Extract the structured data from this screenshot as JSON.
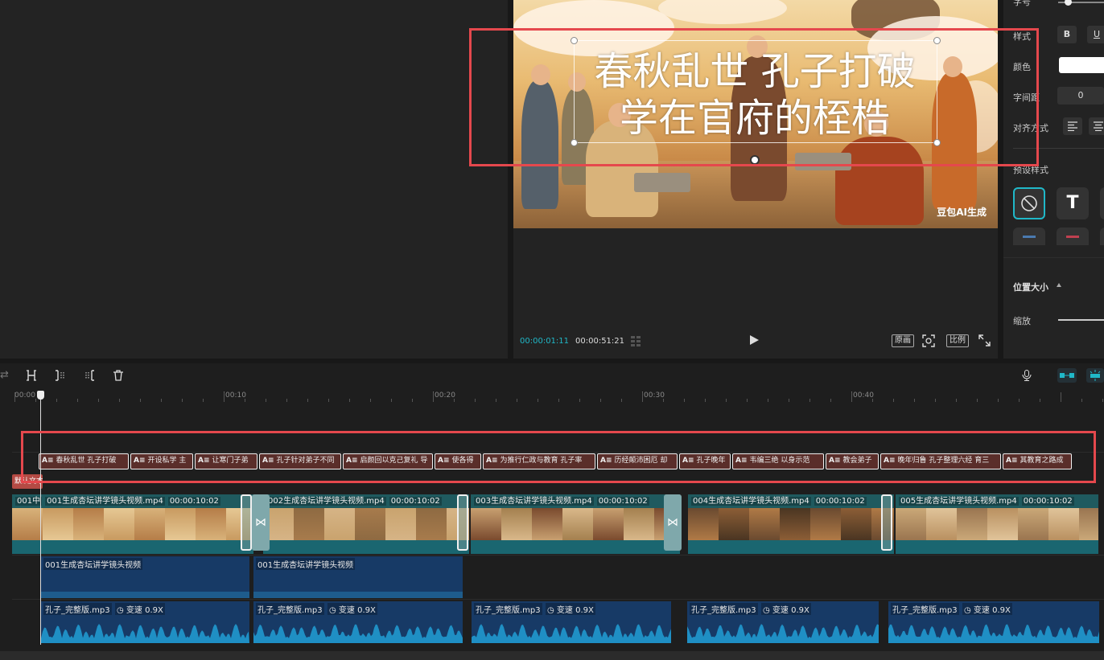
{
  "media_panel": {
    "tab_label": ""
  },
  "preview": {
    "subtitle_line1": "春秋乱世 孔子打破",
    "subtitle_line2": "学在官府的桎梏",
    "watermark": "豆包AI生成",
    "time_current": "00:00:01:11",
    "time_total": "00:00:51:21",
    "btn_original": "原画",
    "btn_ratio": "比例"
  },
  "properties": {
    "font_size_label": "字号",
    "style_label": "样式",
    "bold": "B",
    "underline": "U",
    "color_label": "颜色",
    "spacing_label": "字间距",
    "spacing_value": "0",
    "align_label": "对齐方式",
    "preset_label": "预设样式",
    "preset_t": "T",
    "position_label": "位置大小",
    "scale_label": "缩放"
  },
  "timeline": {
    "ruler": [
      "00:00",
      "|00:10",
      "|00:20",
      "|00:30",
      "|00:40"
    ],
    "text_tag": "默认文本",
    "captions": [
      "春秋乱世 孔子打破",
      "开设私学 主",
      "让寒门子弟",
      "孔子针对弟子不同",
      "启颜回以克己复礼 导",
      "使各得",
      "为推行仁政与教育 孔子率",
      "历经颠沛困厄 却",
      "孔子晚年",
      "韦编三绝 以身示范",
      "教会弟子",
      "晚年归鲁 孔子整理六经 育三",
      "其教育之路成"
    ],
    "caption_badge": "A≡",
    "video_clips": [
      {
        "name": "001生成杏坛讲学镜头视频.mp4",
        "duration": "00:00:10:02",
        "prefix": "001中"
      },
      {
        "name": "002生成杏坛讲学镜头视频.mp4",
        "duration": "00:00:10:02"
      },
      {
        "name": "003生成杏坛讲学镜头视频.mp4",
        "duration": "00:00:10:02"
      },
      {
        "name": "004生成杏坛讲学镜头视频.mp4",
        "duration": "00:00:10:02"
      },
      {
        "name": "005生成杏坛讲学镜头视频.mp4",
        "duration": "00:00:10:02"
      }
    ],
    "video_audio_clips": [
      "001生成杏坛讲学镜头视频",
      "001生成杏坛讲学镜头视频"
    ],
    "music_clip": {
      "name": "孔子_完整版.mp3",
      "speed": "变速 0.9X"
    }
  },
  "colors": {
    "accent": "#20b8c8",
    "highlight_box": "#e5484d",
    "caption_clip": "#5a2e2a",
    "video_clip": "#1d4f55",
    "audio_clip": "#173a66"
  }
}
